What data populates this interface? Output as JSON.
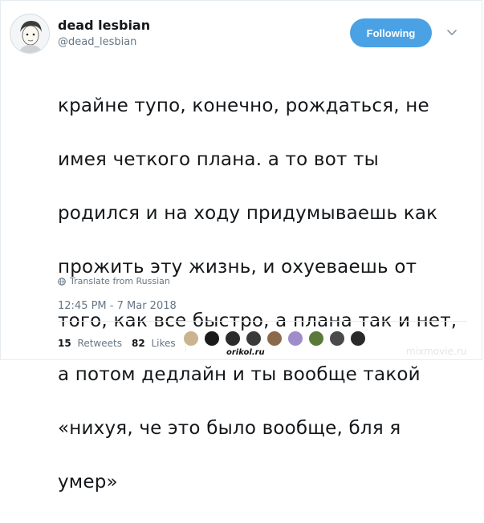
{
  "tweet": {
    "author": {
      "display_name": "dead lesbian",
      "handle": "@dead_lesbian"
    },
    "follow_button_label": "Following",
    "text_lines": [
      "крайне тупо, конечно, рождаться, не",
      "имея четкого плана. а то вот ты",
      "родился и на ходу придумываешь как",
      "прожить эту жизнь, и охуеваешь от",
      "того, как все быстро, а плана так и нет,",
      "а потом дедлайн и ты вообще такой",
      "«нихуя, че это было вообще, бля я",
      "умер»"
    ],
    "translate_label": "Translate from Russian",
    "timestamp": "12:45 PM - 7 Mar 2018",
    "stats": {
      "retweets_count": "15",
      "retweets_label": "Retweets",
      "likes_count": "82",
      "likes_label": "Likes"
    },
    "liker_avatar_colors": [
      "#c9b48f",
      "#1a1a1a",
      "#2b2b2b",
      "#3a3a3a",
      "#8a6a4a",
      "#a08cc8",
      "#5a7a3a",
      "#4a4a4a",
      "#2a2a2a"
    ]
  },
  "watermarks": {
    "orikol": "orikol.ru",
    "mixmovie": "mixmovie.ru"
  },
  "colors": {
    "accent": "#4aa1e4",
    "text": "#14171a",
    "secondary_text": "#657786"
  },
  "icons": {
    "caret": "chevron-down-icon",
    "globe": "globe-icon"
  }
}
